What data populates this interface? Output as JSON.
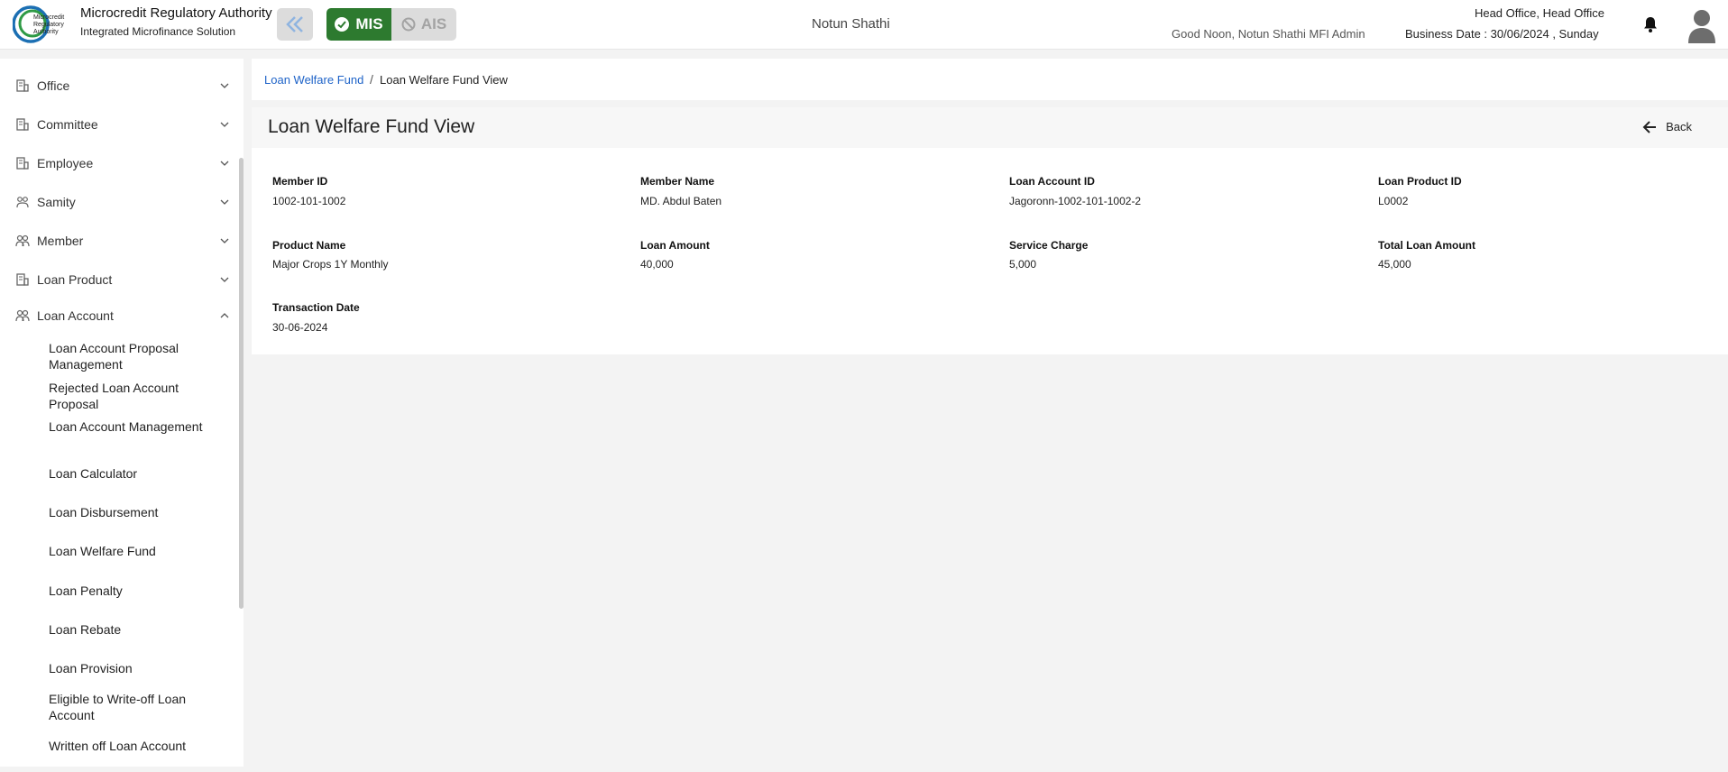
{
  "header": {
    "logo_text": [
      "Microcredit",
      "Regulatory",
      "Authority"
    ],
    "brand_title": "Microcredit Regulatory Authority",
    "brand_subtitle": "Integrated Microfinance Solution",
    "mode_mis": "MIS",
    "mode_ais": "AIS",
    "center_title": "Notun Shathi",
    "greeting": "Good Noon, Notun Shathi MFI Admin",
    "office": "Head Office, Head Office",
    "business_date": "Business Date : 30/06/2024 , Sunday"
  },
  "sidebar": {
    "items": [
      {
        "label": "Office",
        "icon": "building-icon",
        "expanded": false
      },
      {
        "label": "Committee",
        "icon": "building-icon",
        "expanded": false
      },
      {
        "label": "Employee",
        "icon": "building-icon",
        "expanded": false
      },
      {
        "label": "Samity",
        "icon": "group-icon",
        "expanded": false
      },
      {
        "label": "Member",
        "icon": "users-icon",
        "expanded": false
      },
      {
        "label": "Loan Product",
        "icon": "building-icon",
        "expanded": false
      },
      {
        "label": "Loan Account",
        "icon": "users-icon",
        "expanded": true
      }
    ],
    "subitems": [
      "Loan Account Proposal Management",
      "Rejected Loan Account Proposal",
      "Loan Account Management",
      "Loan Calculator",
      "Loan Disbursement",
      "Loan Welfare Fund",
      "Loan Penalty",
      "Loan Rebate",
      "Loan Provision",
      "Eligible to Write-off Loan Account",
      "Written off Loan Account"
    ]
  },
  "breadcrumb": {
    "parent": "Loan Welfare Fund",
    "separator": "/",
    "current": "Loan Welfare Fund View"
  },
  "page": {
    "title": "Loan Welfare Fund View",
    "back_label": "Back"
  },
  "fields": [
    {
      "label": "Member ID",
      "value": "1002-101-1002"
    },
    {
      "label": "Member Name",
      "value": "MD. Abdul Baten"
    },
    {
      "label": "Loan Account ID",
      "value": "Jagoronn-1002-101-1002-2"
    },
    {
      "label": "Loan Product ID",
      "value": "L0002"
    },
    {
      "label": "Product Name",
      "value": "Major Crops 1Y Monthly"
    },
    {
      "label": "Loan Amount",
      "value": "40,000"
    },
    {
      "label": "Service Charge",
      "value": "5,000"
    },
    {
      "label": "Total Loan Amount",
      "value": "45,000"
    },
    {
      "label": "Transaction Date",
      "value": "30-06-2024"
    }
  ],
  "colors": {
    "accent_green": "#2d7a2f",
    "link_blue": "#1e63c8"
  }
}
